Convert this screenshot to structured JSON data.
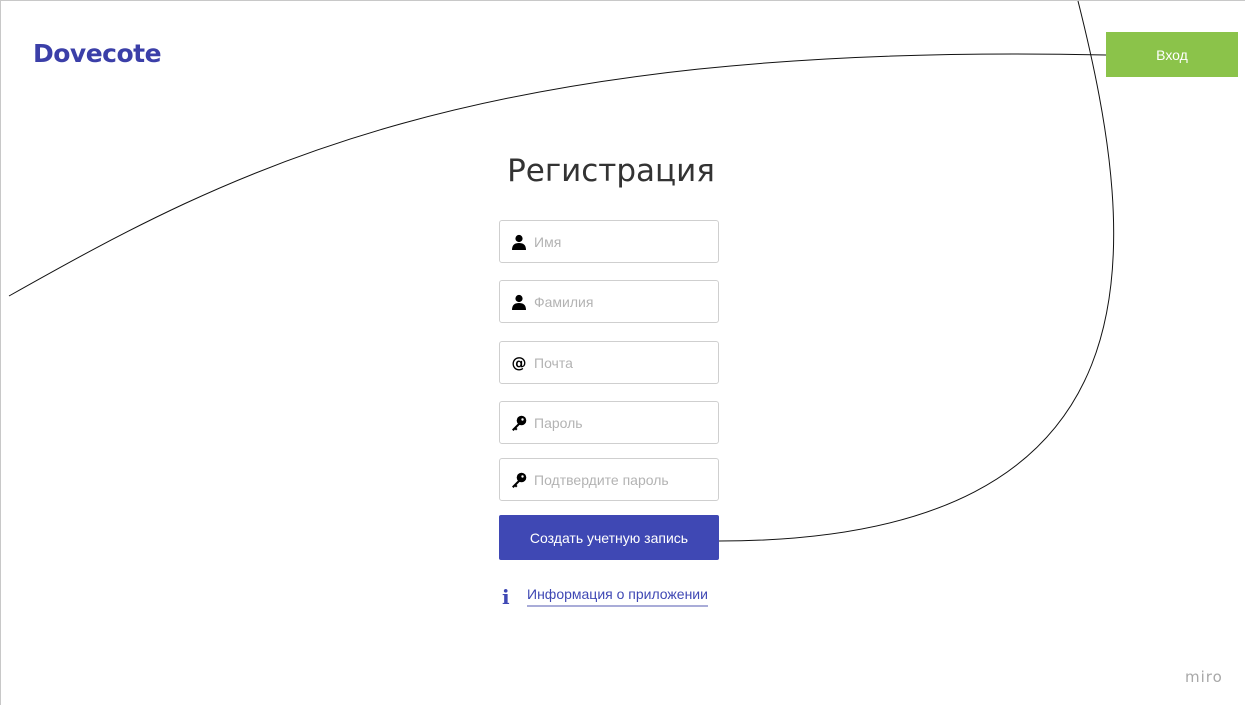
{
  "header": {
    "logo": "Dovecote",
    "login_label": "Вход"
  },
  "form": {
    "title": "Регистрация",
    "fields": [
      {
        "placeholder": "Имя",
        "icon": "user-icon"
      },
      {
        "placeholder": "Фамилия",
        "icon": "user-icon"
      },
      {
        "placeholder": "Почта",
        "icon": "at-icon"
      },
      {
        "placeholder": "Пароль",
        "icon": "key-icon"
      },
      {
        "placeholder": "Подтвердите пароль",
        "icon": "key-icon"
      }
    ],
    "submit_label": "Создать учетную запись",
    "info_link": "Информация о приложении"
  },
  "watermark": "miro",
  "colors": {
    "brand": "#3b3fa8",
    "primary_button": "#3f48b4",
    "login_button": "#8bc34a"
  }
}
